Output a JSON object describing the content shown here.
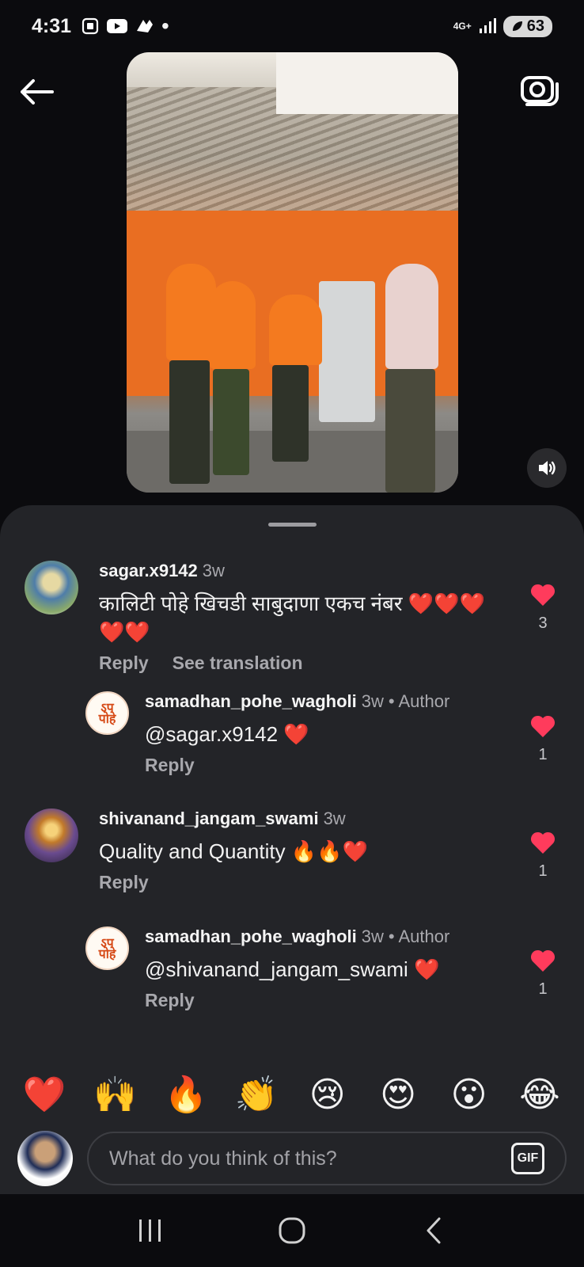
{
  "status_bar": {
    "time": "4:31",
    "network": "4G+",
    "battery": "63"
  },
  "comments": [
    {
      "username": "sagar.x9142",
      "time": "3w",
      "text_line1": "कालिटी पोहे खिचडी साबुदाणा एकच नंबर ❤️❤️❤️",
      "text_line2": "❤️❤️",
      "reply_label": "Reply",
      "translate_label": "See translation",
      "likes": "3"
    },
    {
      "username": "samadhan_pohe_wagholi",
      "time": "3w",
      "author_tag": "• Author",
      "text": "@sagar.x9142 ❤️",
      "reply_label": "Reply",
      "likes": "1"
    },
    {
      "username": "shivanand_jangam_swami",
      "time": "3w",
      "text": "Quality and Quantity 🔥🔥❤️",
      "reply_label": "Reply",
      "likes": "1"
    },
    {
      "username": "samadhan_pohe_wagholi",
      "time": "3w",
      "author_tag": "• Author",
      "text": "@shivanand_jangam_swami ❤️",
      "reply_label": "Reply",
      "likes": "1"
    }
  ],
  "emoji_bar": [
    "❤️",
    "🙌",
    "🔥",
    "👏",
    "😢",
    "😍",
    "😮",
    "😂"
  ],
  "input": {
    "placeholder": "What do you think of this?",
    "gif_label": "GIF"
  },
  "icons": {
    "back": "arrow-left",
    "camera": "camera",
    "mute": "speaker",
    "heart_color": "#ff3b5c"
  }
}
